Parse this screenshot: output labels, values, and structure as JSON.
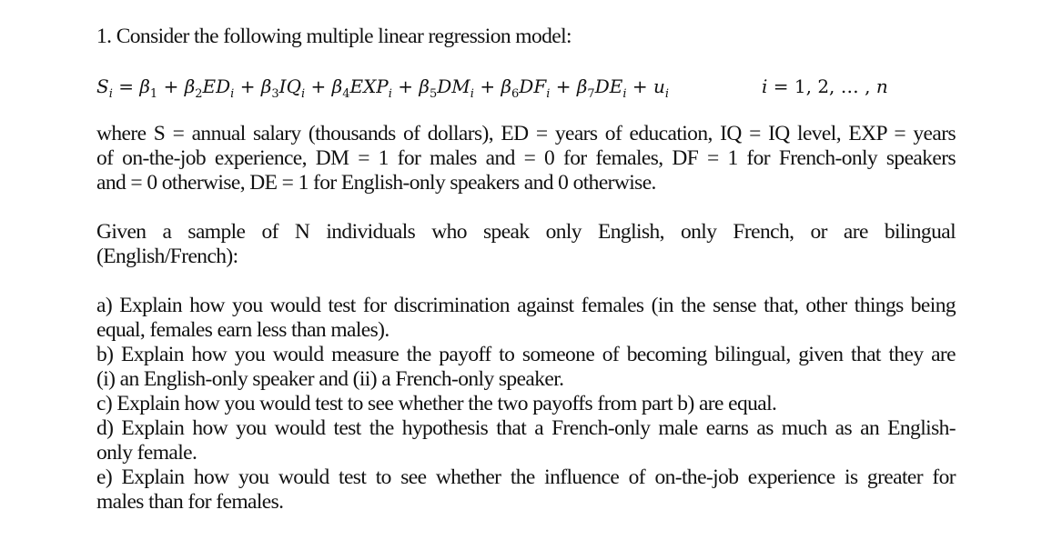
{
  "question": {
    "heading": "1. Consider the following multiple linear regression model:",
    "equation": {
      "lhs": "S",
      "terms": [
        {
          "coef": "β",
          "coef_sub": "1",
          "var": "",
          "var_sub": ""
        },
        {
          "coef": "β",
          "coef_sub": "2",
          "var": "ED",
          "var_sub": "i"
        },
        {
          "coef": "β",
          "coef_sub": "3",
          "var": "IQ",
          "var_sub": "i"
        },
        {
          "coef": "β",
          "coef_sub": "4",
          "var": "EXP",
          "var_sub": "i"
        },
        {
          "coef": "β",
          "coef_sub": "5",
          "var": "DM",
          "var_sub": "i"
        },
        {
          "coef": "β",
          "coef_sub": "6",
          "var": "DF",
          "var_sub": "i"
        },
        {
          "coef": "β",
          "coef_sub": "7",
          "var": "DE",
          "var_sub": "i"
        }
      ],
      "error": "u",
      "index_var": "i",
      "index_range": "= 1, 2, … , ",
      "index_end": "n"
    },
    "definitions": [
      "where S = annual salary (thousands of dollars), ED = years of education, IQ = IQ level, EXP = years",
      "of on-the-job experience, DM = 1 for males and = 0 for females, DF = 1 for French-only speakers",
      "and = 0 otherwise, DE = 1 for English-only speakers and 0 otherwise."
    ],
    "sample": [
      "Given a sample of N individuals who speak only English, only French, or are bilingual",
      "(English/French):"
    ],
    "parts": [
      "a) Explain how you would test for discrimination against females (in the sense that, other things being",
      "equal, females earn less than males).",
      "b) Explain how you would measure the payoff to someone of becoming bilingual, given that they are",
      "(i) an English-only speaker and (ii) a French-only speaker.",
      "c) Explain how you would test to see whether the two payoffs from part b) are equal.",
      "d) Explain how you would test the hypothesis that a French-only male earns as much as an English-",
      "only female.",
      "e) Explain how you would test to see whether the influence of on-the-job experience is greater for",
      "males than for females."
    ]
  }
}
